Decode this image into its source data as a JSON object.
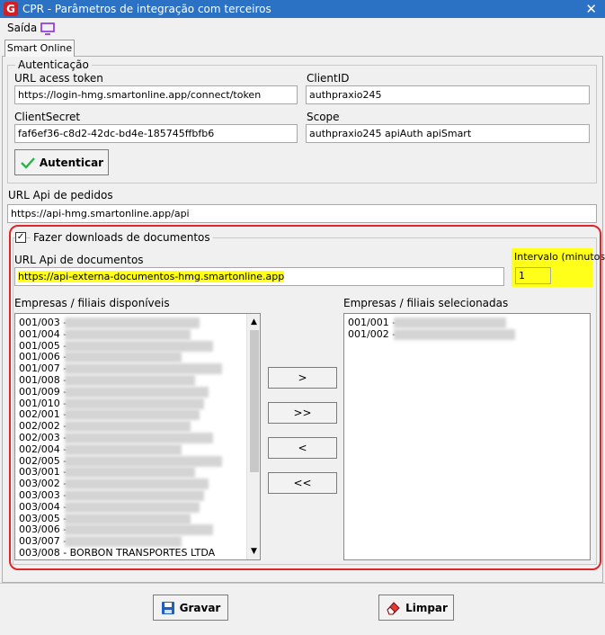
{
  "window": {
    "title": "CPR - Parâmetros de integração com terceiros",
    "close_glyph": "✕",
    "app_icon_letter": "G"
  },
  "menu": {
    "saida_label": "Saída"
  },
  "tab": {
    "label": "Smart Online"
  },
  "autenticacao": {
    "legend": "Autenticação",
    "url_token_label": "URL acess token",
    "url_token_value": "https://login-hmg.smartonline.app/connect/token",
    "client_id_label": "ClientID",
    "client_id_value": "authpraxio245",
    "client_secret_label": "ClientSecret",
    "client_secret_value": "faf6ef36-c8d2-42dc-bd4e-185745ffbfb6",
    "scope_label": "Scope",
    "scope_value": "authpraxio245 apiAuth apiSmart",
    "autenticar_label": "Autenticar"
  },
  "pedidos": {
    "label": "URL Api de pedidos",
    "value": "https://api-hmg.smartonline.app/api"
  },
  "documentos": {
    "checkbox_label": "Fazer downloads de documentos",
    "checked_glyph": "✓",
    "url_label": "URL Api de documentos",
    "url_value": "https://api-externa-documentos-hmg.smartonline.app",
    "intervalo_label": "Intervalo (minutos)",
    "intervalo_value": "1",
    "disponiveis_label": "Empresas / filiais disponíveis",
    "selecionadas_label": "Empresas / filiais selecionadas",
    "disponiveis": [
      "001/003 -",
      "001/004 -",
      "001/005 -",
      "001/006 -",
      "001/007 -",
      "001/008 -",
      "001/009 -",
      "001/010 -",
      "002/001 -",
      "002/002 -",
      "002/003 -",
      "002/004 -",
      "002/005 -",
      "003/001 -",
      "003/002 -",
      "003/003 -",
      "003/004 -",
      "003/005 -",
      "003/006 -",
      "003/007 -",
      "003/008 - BORBON TRANSPORTES LTDA"
    ],
    "selecionadas": [
      "001/001 -",
      "001/002 -"
    ],
    "btn_add": ">",
    "btn_add_all": ">>",
    "btn_remove": "<",
    "btn_remove_all": "<<"
  },
  "footer": {
    "gravar_label": "Gravar",
    "limpar_label": "Limpar"
  },
  "colors": {
    "title_bar": "#2b71c4",
    "highlight": "#ffff1a",
    "annotation_red": "#e0262a"
  }
}
